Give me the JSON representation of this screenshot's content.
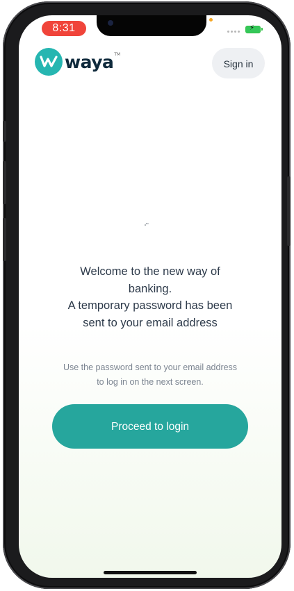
{
  "status_bar": {
    "time": "8:31",
    "battery_color": "#34c759",
    "time_pill_color": "#f0443a"
  },
  "header": {
    "logo_text": "waya",
    "logo_tm": "TM",
    "logo_icon": "waya-w-logo-icon",
    "signin_label": "Sign in"
  },
  "main": {
    "heading_lines": [
      "Welcome to the new way of",
      "banking.",
      "A temporary password has been",
      "sent to your email address"
    ],
    "subtext_lines": [
      "Use the password sent to your email address",
      "to log in on the next screen."
    ],
    "proceed_label": "Proceed to login"
  },
  "colors": {
    "brand": "#26b6b1",
    "primary_button": "#26a69d",
    "text_dark": "#2d3a4a",
    "text_muted": "#7c8591"
  }
}
